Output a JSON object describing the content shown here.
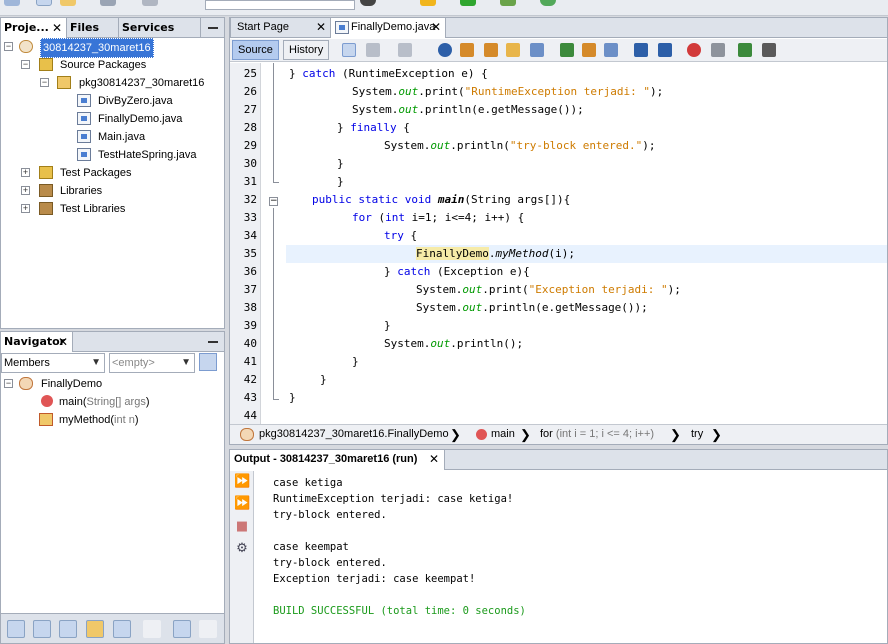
{
  "projects": {
    "tabs": [
      {
        "label": "Proje...",
        "active": true
      },
      {
        "label": "Files",
        "active": false
      },
      {
        "label": "Services",
        "active": false
      }
    ],
    "tree": [
      {
        "label": "30814237_30maret16",
        "selected": true
      },
      {
        "label": "Source Packages"
      },
      {
        "label": "pkg30814237_30maret16"
      },
      {
        "label": "DivByZero.java"
      },
      {
        "label": "FinallyDemo.java"
      },
      {
        "label": "Main.java"
      },
      {
        "label": "TestHateSpring.java"
      },
      {
        "label": "Test Packages"
      },
      {
        "label": "Libraries"
      },
      {
        "label": "Test Libraries"
      }
    ]
  },
  "navigator": {
    "title": "Navigator",
    "filter_selected": "Members",
    "scope_selected": "<empty>",
    "tree": {
      "class_name": "FinallyDemo",
      "members": [
        {
          "name": "main(",
          "params": "String[] args",
          "close": ")"
        },
        {
          "name": "myMethod(",
          "params": "int n",
          "close": ")"
        }
      ]
    }
  },
  "editor": {
    "tabs": [
      {
        "label": "Start Page",
        "active": false
      },
      {
        "label": "FinallyDemo.java",
        "active": true
      }
    ],
    "source_label": "Source",
    "history_label": "History",
    "line_numbers": [
      "25",
      "26",
      "27",
      "28",
      "29",
      "30",
      "31",
      "32",
      "33",
      "34",
      "35",
      "36",
      "37",
      "38",
      "39",
      "40",
      "41",
      "42",
      "43",
      "44"
    ],
    "highlighted_line": "35",
    "breadcrumb": {
      "class": "pkg30814237_30maret16.FinallyDemo",
      "method": "main",
      "loop_kw": "for",
      "loop_args": "(int i = 1; i <= 4; i++)",
      "block": "try"
    }
  },
  "code": {
    "l25_a": "} ",
    "l25_kw": "catch",
    "l25_b": " (RuntimeException e) {",
    "l26_a": "System.",
    "l26_fld": "out",
    "l26_b": ".print(",
    "l26_str": "\"RuntimeException terjadi: \"",
    "l26_c": ");",
    "l27_a": "System.",
    "l27_fld": "out",
    "l27_b": ".println(e.getMessage());",
    "l28_a": "} ",
    "l28_kw": "finally",
    "l28_b": " {",
    "l29_a": "System.",
    "l29_fld": "out",
    "l29_b": ".println(",
    "l29_str": "\"try-block entered.\"",
    "l29_c": ");",
    "l30": "}",
    "l31": "}",
    "l32_kw": "public static void ",
    "l32_m": "main",
    "l32_b": "(String args[]){",
    "l33_kw": "for",
    "l33_a": " (",
    "l33_kw2": "int",
    "l33_b": " i=1; i<=4; i++) {",
    "l34_kw": "try",
    "l34_b": " {",
    "l35_cls": "FinallyDemo",
    "l35_dot": ".",
    "l35_m": "myMethod",
    "l35_b": "(i);",
    "l36_a": "} ",
    "l36_kw": "catch",
    "l36_b": " (Exception e){",
    "l37_a": "System.",
    "l37_fld": "out",
    "l37_b": ".print(",
    "l37_str": "\"Exception terjadi: \"",
    "l37_c": ");",
    "l38_a": "System.",
    "l38_fld": "out",
    "l38_b": ".println(e.getMessage());",
    "l39": "}",
    "l40_a": "System.",
    "l40_fld": "out",
    "l40_b": ".println();",
    "l41": "}",
    "l42": "}",
    "l43": "}",
    "l44": ""
  },
  "output": {
    "title": "Output - 30814237_30maret16 (run)",
    "lines": [
      "case ketiga",
      "RuntimeException terjadi: case ketiga!",
      "try-block entered.",
      "",
      "case keempat",
      "try-block entered.",
      "Exception terjadi: case keempat!",
      "",
      "BUILD SUCCESSFUL (total time: 0 seconds)"
    ]
  },
  "colors": {
    "keyword": "#0000e6",
    "string": "#ce7b00",
    "field": "#009900",
    "selection": "#3875d7",
    "build_success": "#1b9a1b"
  }
}
